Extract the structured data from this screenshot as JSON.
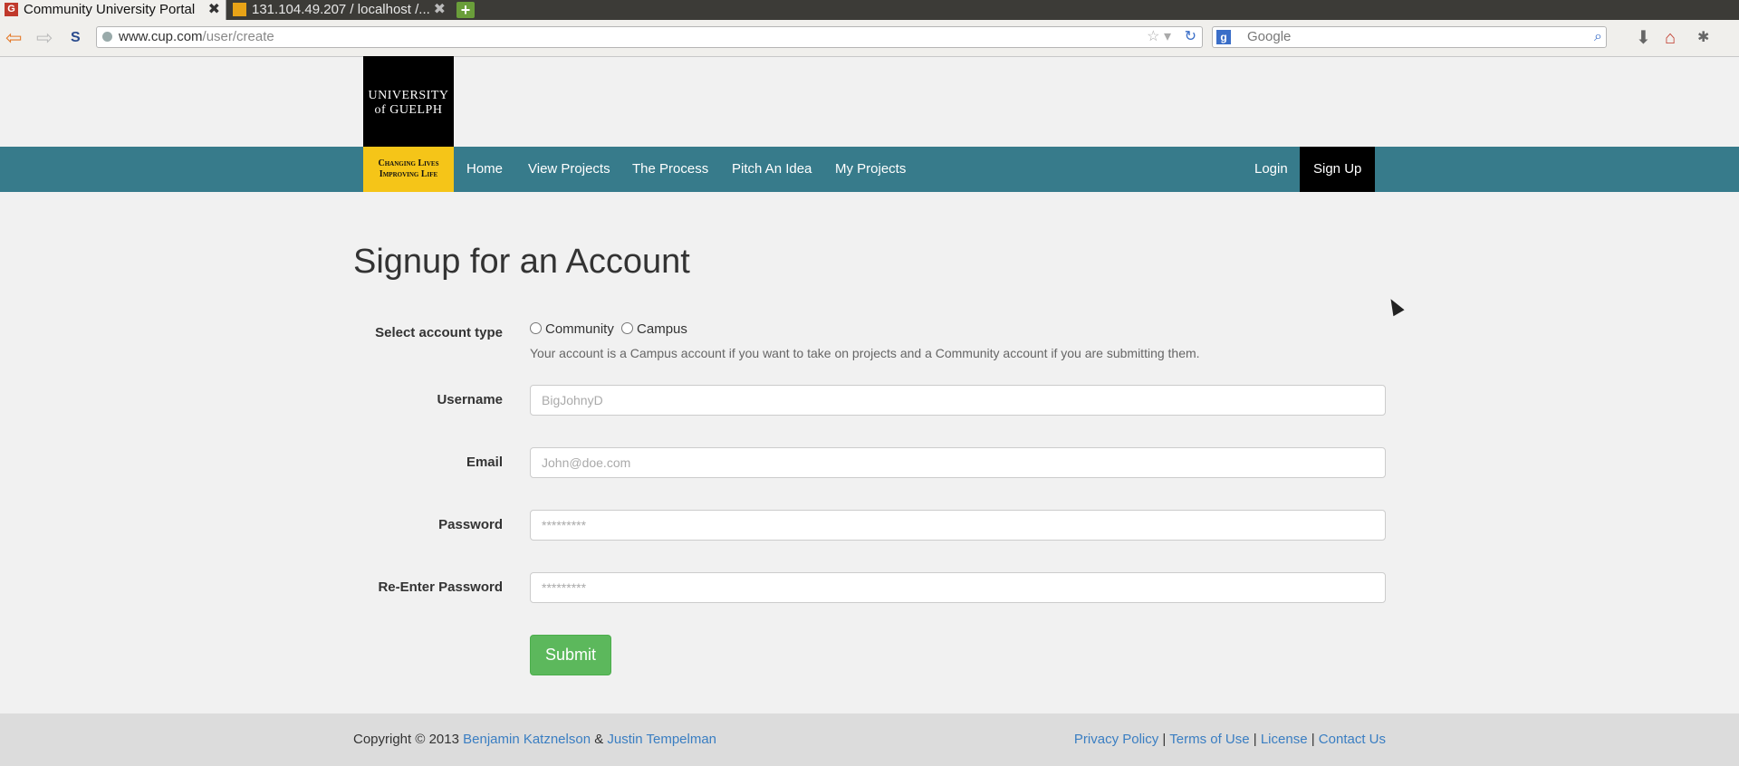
{
  "browser": {
    "tabs": [
      {
        "title": "Community University Portal",
        "favicon": "G",
        "active": true
      },
      {
        "title": "131.104.49.207 / localhost /...",
        "favicon": "pma",
        "active": false
      }
    ],
    "new_tab_label": "+",
    "url_host": "www.cup.com",
    "url_path": "/user/create",
    "search_placeholder": "Google",
    "search_engine_badge": "g"
  },
  "logo": {
    "line1": "UNIVERSITY",
    "line2": "of GUELPH",
    "tagline1": "Changing Lives",
    "tagline2": "Improving Life"
  },
  "nav": {
    "items": [
      "Home",
      "View Projects",
      "The Process",
      "Pitch An Idea",
      "My Projects"
    ],
    "login": "Login",
    "signup": "Sign Up",
    "bar_color": "#377b8b"
  },
  "form": {
    "title": "Signup for an Account",
    "account_type_label": "Select account type",
    "account_types": [
      "Community",
      "Campus"
    ],
    "help_text": "Your account is a Campus account if you want to take on projects and a Community account if you are submitting them.",
    "fields": [
      {
        "label": "Username",
        "placeholder": "BigJohnyD"
      },
      {
        "label": "Email",
        "placeholder": "John@doe.com"
      },
      {
        "label": "Password",
        "placeholder": "*********"
      },
      {
        "label": "Re-Enter Password",
        "placeholder": "*********"
      }
    ],
    "submit": "Submit",
    "submit_color": "#5cb85c"
  },
  "footer": {
    "copyright": "Copyright © 2013",
    "author1": "Benjamin Katznelson",
    "amp": "&",
    "author2": "Justin Tempelman",
    "links": [
      "Privacy Policy",
      "Terms of Use",
      "License",
      "Contact Us"
    ],
    "separator": "|"
  }
}
